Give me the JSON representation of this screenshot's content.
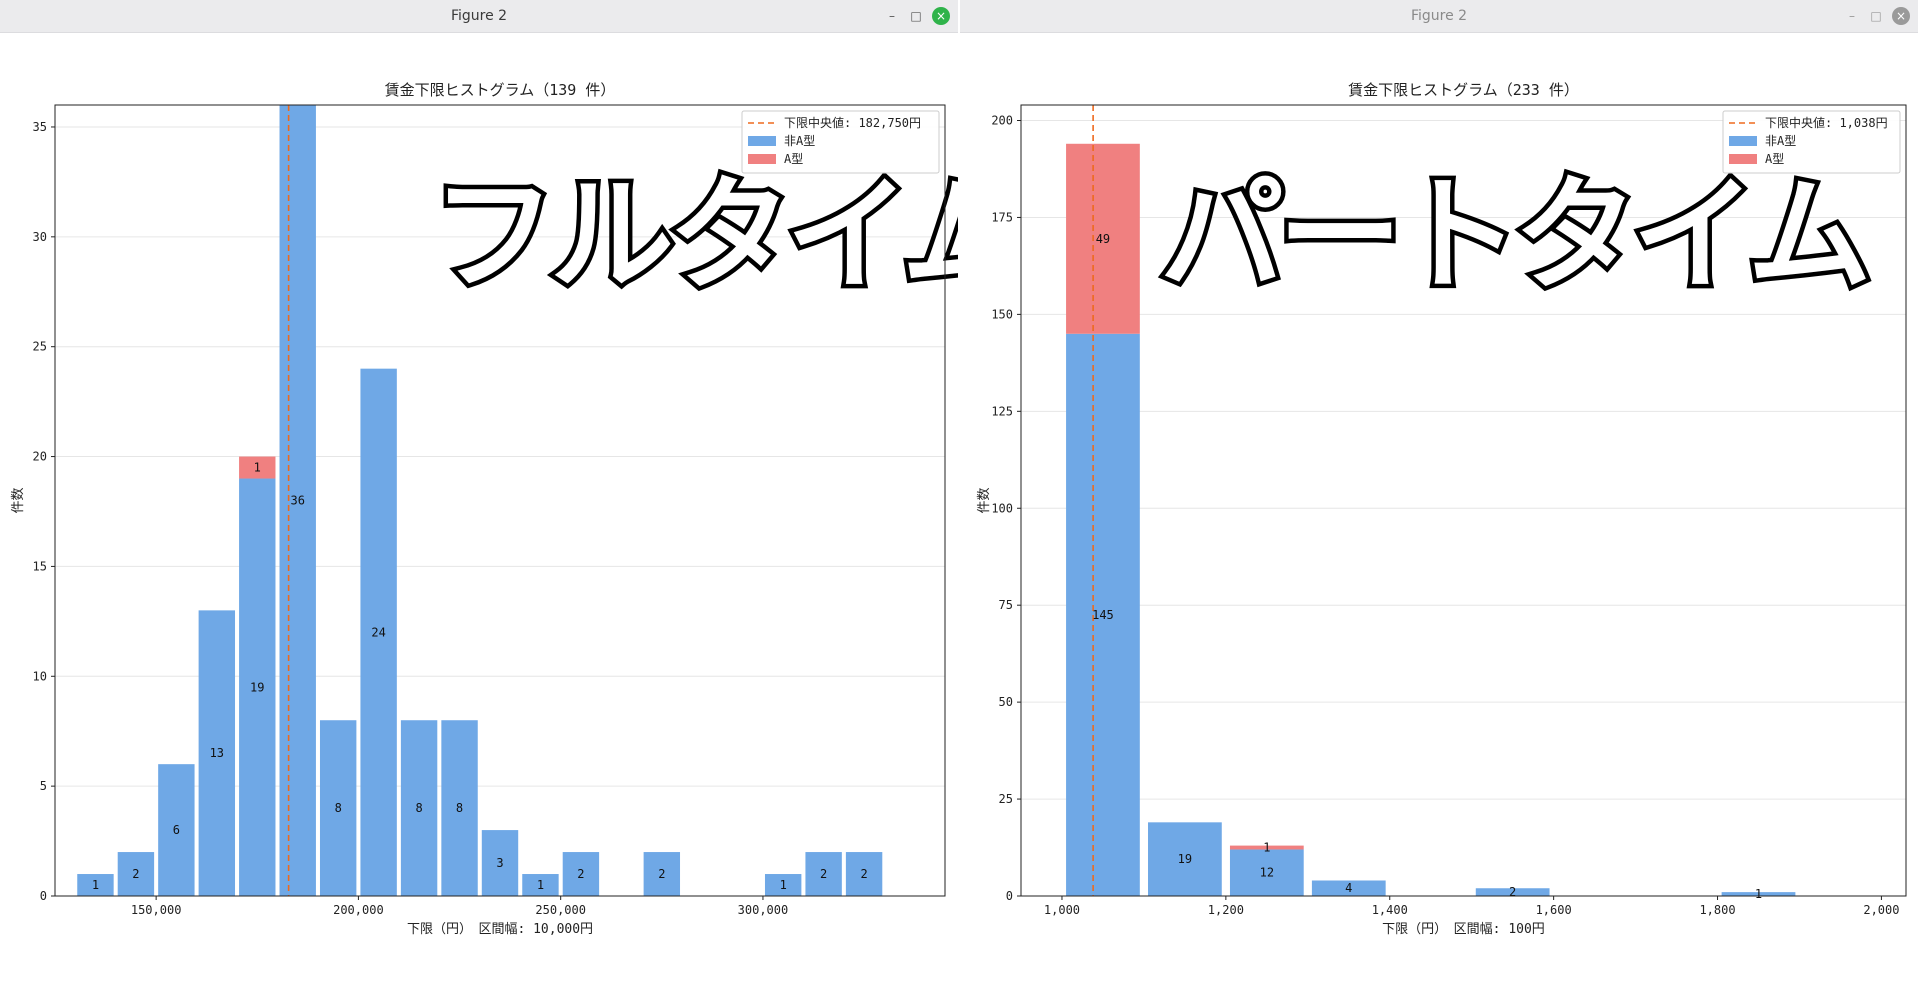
{
  "windows": [
    {
      "title": "Figure 2",
      "active": true
    },
    {
      "title": "Figure 2",
      "active": false
    }
  ],
  "window_controls": {
    "minimize": "–",
    "maximize": "□",
    "close": "×"
  },
  "chart_data": [
    {
      "type": "bar",
      "stacked": true,
      "title": "賃金下限ヒストグラム（139 件）",
      "xlabel": "下限（円）　区間幅: 10,000円",
      "ylabel": "件数",
      "overlay_text": "フルタイム",
      "xlim": [
        125000,
        345000
      ],
      "ylim": [
        0,
        36
      ],
      "yticks": [
        0,
        5,
        10,
        15,
        20,
        25,
        30,
        35
      ],
      "xticks": [
        150000,
        200000,
        250000,
        300000
      ],
      "xtick_labels": [
        "150,000",
        "200,000",
        "250,000",
        "300,000"
      ],
      "bin_width": 10000,
      "bins": [
        130000,
        140000,
        150000,
        160000,
        170000,
        180000,
        190000,
        200000,
        210000,
        220000,
        230000,
        240000,
        250000,
        260000,
        270000,
        280000,
        290000,
        300000,
        310000,
        320000
      ],
      "series": [
        {
          "name": "非A型",
          "color": "#6fa8e6",
          "values": [
            1,
            2,
            6,
            13,
            19,
            36,
            8,
            24,
            8,
            8,
            3,
            1,
            2,
            0,
            2,
            0,
            0,
            1,
            2,
            2
          ]
        },
        {
          "name": "A型",
          "color": "#f08080",
          "values": [
            0,
            0,
            0,
            0,
            1,
            0,
            0,
            0,
            0,
            0,
            0,
            0,
            0,
            0,
            0,
            0,
            0,
            0,
            0,
            0
          ]
        }
      ],
      "median": {
        "label": "下限中央値: 182,750円",
        "value": 182750,
        "color": "#ee6a1e"
      },
      "grid": "y",
      "legend_placement": "top-right"
    },
    {
      "type": "bar",
      "stacked": true,
      "title": "賃金下限ヒストグラム（233 件）",
      "xlabel": "下限（円）　区間幅: 100円",
      "ylabel": "件数",
      "overlay_text": "パートタイム",
      "xlim": [
        950,
        2030
      ],
      "ylim": [
        0,
        204
      ],
      "yticks": [
        0,
        25,
        50,
        75,
        100,
        125,
        150,
        175,
        200
      ],
      "xticks": [
        1000,
        1200,
        1400,
        1600,
        1800,
        2000
      ],
      "xtick_labels": [
        "1,000",
        "1,200",
        "1,400",
        "1,600",
        "1,800",
        "2,000"
      ],
      "bin_width": 100,
      "bins": [
        1000,
        1100,
        1200,
        1300,
        1400,
        1500,
        1600,
        1700,
        1800,
        1900
      ],
      "series": [
        {
          "name": "非A型",
          "color": "#6fa8e6",
          "values": [
            145,
            19,
            12,
            4,
            0,
            2,
            0,
            0,
            1,
            0
          ]
        },
        {
          "name": "A型",
          "color": "#f08080",
          "values": [
            49,
            0,
            1,
            0,
            0,
            0,
            0,
            0,
            0,
            0
          ]
        }
      ],
      "median": {
        "label": "下限中央値: 1,038円",
        "value": 1038,
        "color": "#ee6a1e"
      },
      "grid": "y",
      "legend_placement": "top-right"
    }
  ]
}
